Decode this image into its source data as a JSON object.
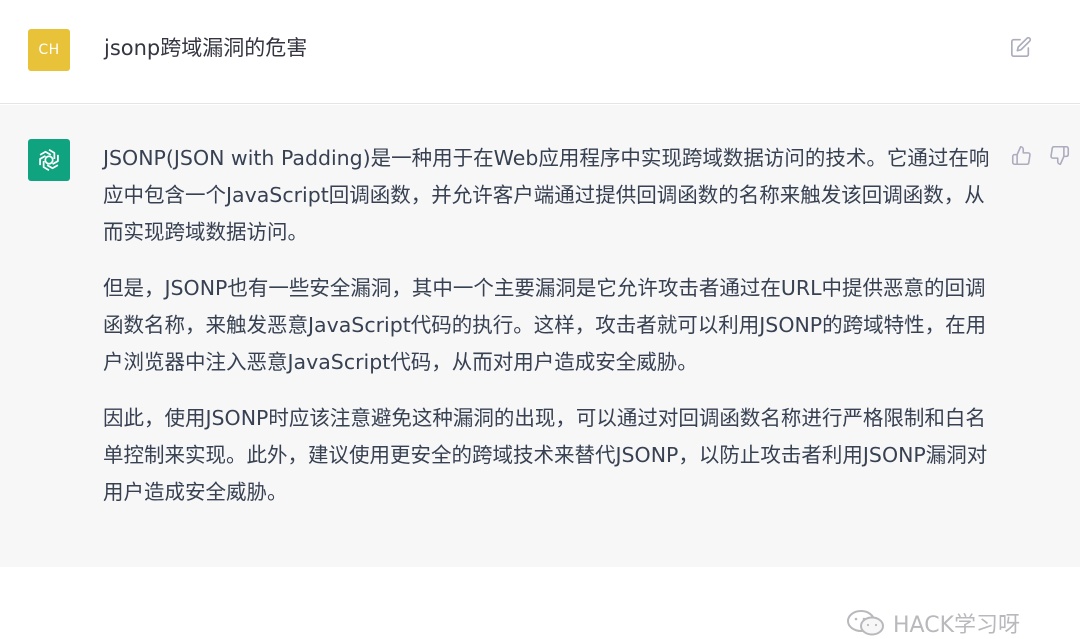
{
  "user_message": {
    "avatar_initials": "CH",
    "text": "jsonp跨域漏洞的危害",
    "avatar_color": "#e8c238"
  },
  "assistant_message": {
    "avatar_color": "#10a37f",
    "paragraphs": [
      "JSONP(JSON with Padding)是一种用于在Web应用程序中实现跨域数据访问的技术。它通过在响应中包含一个JavaScript回调函数，并允许客户端通过提供回调函数的名称来触发该回调函数，从而实现跨域数据访问。",
      "但是，JSONP也有一些安全漏洞，其中一个主要漏洞是它允许攻击者通过在URL中提供恶意的回调函数名称，来触发恶意JavaScript代码的执行。这样，攻击者就可以利用JSONP的跨域特性，在用户浏览器中注入恶意JavaScript代码，从而对用户造成安全威胁。",
      "因此，使用JSONP时应该注意避免这种漏洞的出现，可以通过对回调函数名称进行严格限制和白名单控制来实现。此外，建议使用更安全的跨域技术来替代JSONP，以防止攻击者利用JSONP漏洞对用户造成安全威胁。"
    ]
  },
  "icons": {
    "edit": "edit-icon",
    "openai_logo": "openai-logo-icon",
    "thumbs_up": "thumbs-up-icon",
    "thumbs_down": "thumbs-down-icon",
    "wechat": "wechat-icon"
  },
  "watermark": {
    "text": "HACK学习呀"
  }
}
